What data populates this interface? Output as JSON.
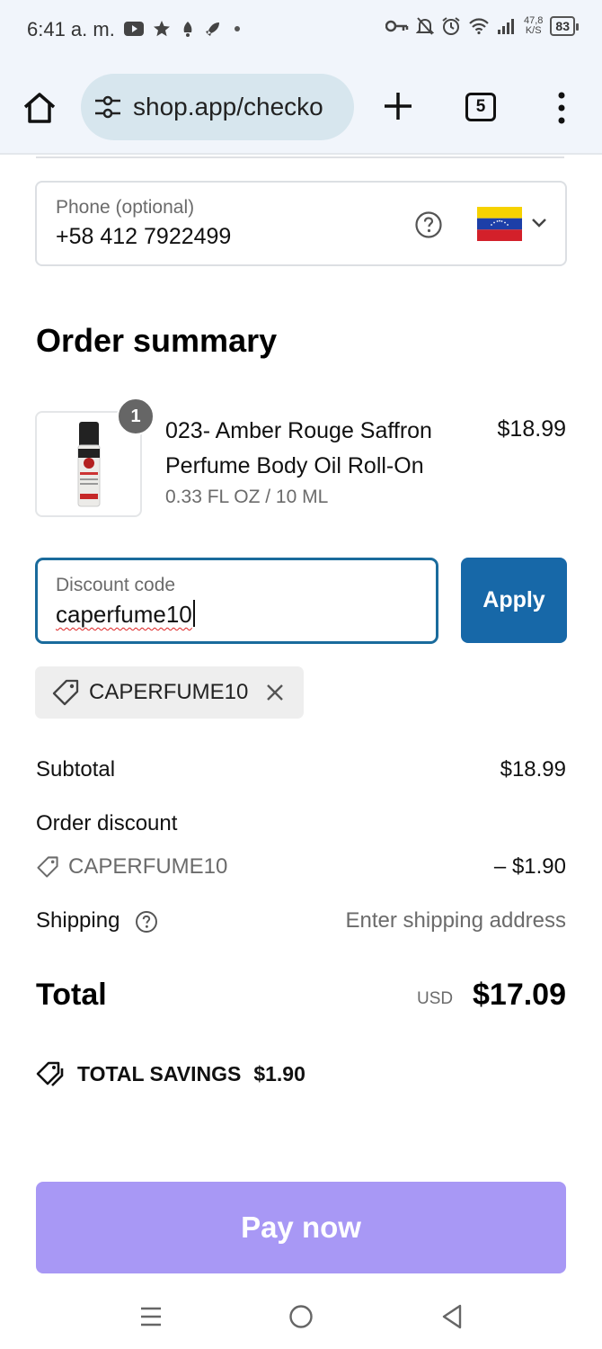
{
  "status_bar": {
    "time": "6:41 a. m.",
    "network_speed_value": "47,8",
    "network_speed_unit": "K/S",
    "battery": "83"
  },
  "browser": {
    "url": "shop.app/checko",
    "tab_count": "5"
  },
  "phone_field": {
    "label": "Phone (optional)",
    "value": "+58 412 7922499",
    "country_flag": "venezuela-flag-icon"
  },
  "order_summary": {
    "title": "Order summary",
    "product": {
      "quantity": "1",
      "name": "023- Amber Rouge Saffron Perfume Body Oil Roll-On",
      "variant": "0.33 FL OZ / 10 ML",
      "price": "$18.99"
    }
  },
  "discount": {
    "label": "Discount code",
    "value": "caperfume10",
    "apply_label": "Apply",
    "applied_code": "CAPERFUME10"
  },
  "totals": {
    "subtotal_label": "Subtotal",
    "subtotal_value": "$18.99",
    "order_discount_label": "Order discount",
    "discount_code": "CAPERFUME10",
    "discount_value": "– $1.90",
    "shipping_label": "Shipping",
    "shipping_value": "Enter shipping address",
    "total_label": "Total",
    "total_currency": "USD",
    "total_value": "$17.09",
    "savings_label": "TOTAL SAVINGS",
    "savings_value": "$1.90"
  },
  "pay_button": {
    "label": "Pay now",
    "color": "#a898f5"
  },
  "colors": {
    "accent_blue": "#1768a8",
    "focus_border": "#1a6b9c"
  }
}
